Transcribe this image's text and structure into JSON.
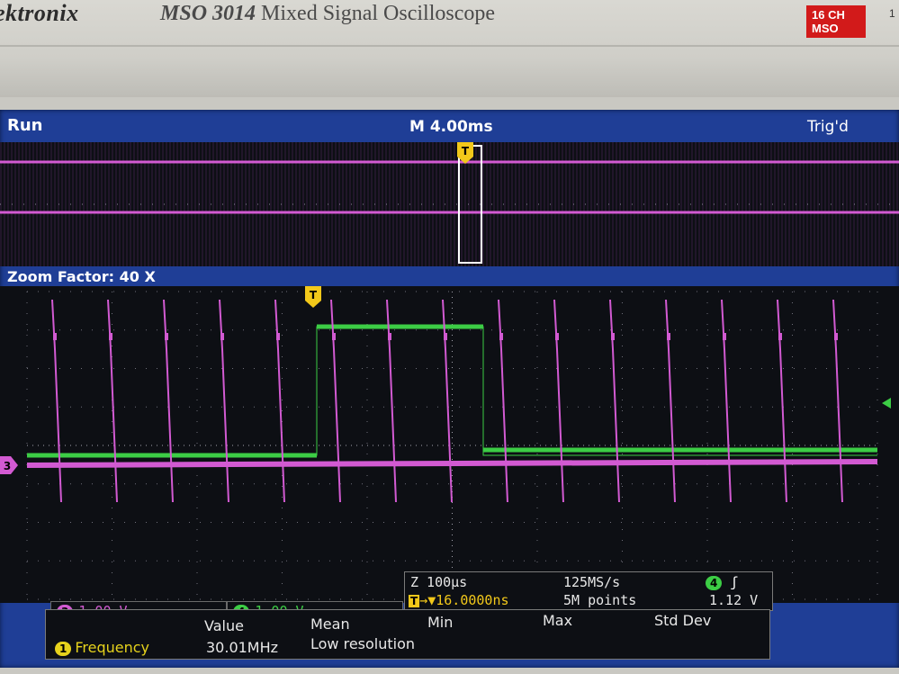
{
  "instrument": {
    "brand": "ektronix",
    "model_bold": "MSO 3014",
    "model_rest": "Mixed Signal Oscilloscope",
    "badge_line1": "16 CH",
    "badge_line2": "MSO",
    "corner": "1"
  },
  "status_bar": {
    "run_state": "Run",
    "main_timebase": "M 4.00ms",
    "trigger_status": "Trig'd"
  },
  "zoom": {
    "label": "Zoom Factor: 40 X"
  },
  "trigger_marker": "T",
  "channels": [
    {
      "id": "3",
      "scale": "1.00 V",
      "color": "#d25ad2"
    },
    {
      "id": "4",
      "scale": "1.00 V",
      "color": "#3ccd45"
    }
  ],
  "ground_marker": "3",
  "horizontal": {
    "zoom_timebase": "Z 100µs",
    "sample_rate": "125MS/s",
    "trigger_position": "16.0000ns",
    "record_length": "5M points",
    "trigger_channel": "4",
    "trigger_level": "1.12 V"
  },
  "measurements": {
    "headers": [
      "Value",
      "Mean",
      "Min",
      "Max",
      "Std Dev"
    ],
    "rows": [
      {
        "channel": "1",
        "name": "Frequency",
        "value": "30.01MHz",
        "note": "Low resolution"
      }
    ]
  },
  "colors": {
    "screen_bezel": "#1f3e96",
    "graticule_bg": "#0d0f14",
    "ch3_magenta": "#d25ad2",
    "ch4_green": "#3ccd45",
    "trigger_yellow": "#f2c81a",
    "ch1_yellow": "#e6d21c"
  }
}
